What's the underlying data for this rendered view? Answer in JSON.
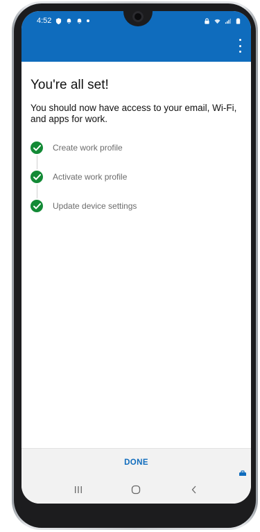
{
  "status_bar": {
    "time": "4:52",
    "left_icons": [
      "shield-icon",
      "bell-icon",
      "bell-icon"
    ],
    "right_icons": [
      "lock-icon",
      "wifi-icon",
      "signal-icon",
      "battery-icon"
    ]
  },
  "app_bar": {
    "menu_icon": "more-vert-icon",
    "color": "#0f6cbd"
  },
  "content": {
    "title": "You're all set!",
    "subtitle": "You should now have access to your email, Wi-Fi, and apps for work."
  },
  "steps": [
    {
      "label": "Create work profile",
      "icon": "check-circle-icon"
    },
    {
      "label": "Activate work profile",
      "icon": "check-circle-icon"
    },
    {
      "label": "Update device settings",
      "icon": "check-circle-icon"
    }
  ],
  "actions": {
    "done_label": "DONE"
  },
  "nav_bar": {
    "buttons": [
      "recents-icon",
      "home-icon",
      "back-icon"
    ]
  },
  "colors": {
    "accent": "#0f6cbd",
    "success": "#138a36"
  }
}
